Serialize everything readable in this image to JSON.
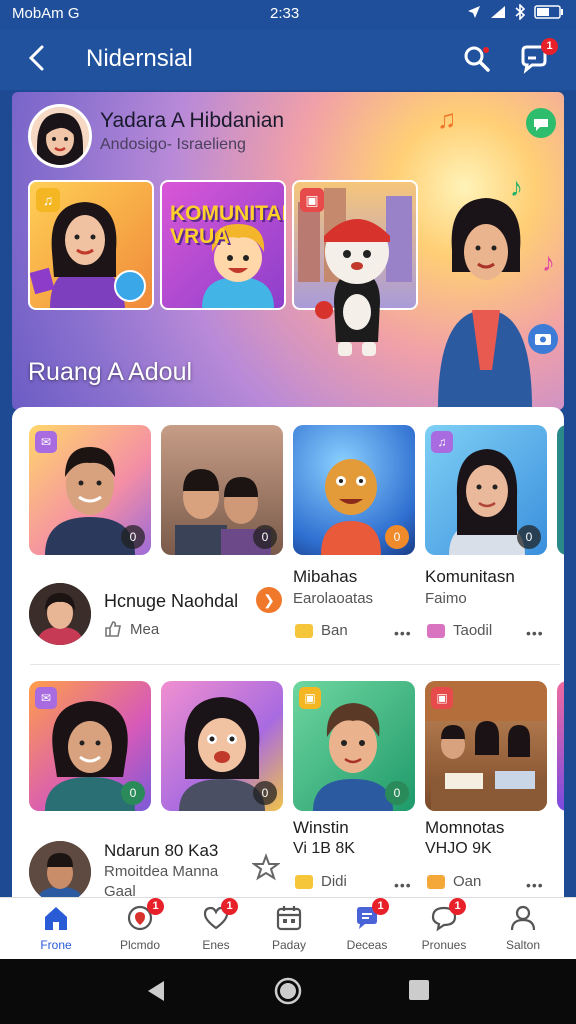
{
  "status": {
    "left": "MobAm G",
    "time": "2:33"
  },
  "appbar": {
    "title": "Nidernsial",
    "chat_badge": "1"
  },
  "hero": {
    "name": "Yadara A Hibdanian",
    "subtitle": "Andosigo- Israelieng",
    "title": "Ruang A Adoul",
    "card_text": "KOMUNITAN VRUA"
  },
  "row1": {
    "badges": [
      "0",
      "0",
      "0",
      "0"
    ],
    "user": {
      "name": "Hcnuge Naohdal",
      "meta": "Mea"
    },
    "items": [
      {
        "title": "Mibahas",
        "sub": "Earolaoatas",
        "meta": "Ban"
      },
      {
        "title": "Komunitasn",
        "sub": "Faimo",
        "meta": "Taodil"
      }
    ]
  },
  "row2": {
    "badges": [
      "0",
      "0",
      "0"
    ],
    "user": {
      "name": "Ndarun 80 Ka3",
      "sub": "Rmoitdea Manna",
      "meta": "Gaal"
    },
    "items": [
      {
        "title": "Winstin",
        "sub": "Vi 1B 8K",
        "meta": "Didi"
      },
      {
        "title": "Momnotas",
        "sub": "VHJO 9K",
        "meta": "Oan"
      }
    ]
  },
  "nav": [
    {
      "label": "Frone",
      "icon": "home-icon",
      "badge": ""
    },
    {
      "label": "Plcmdo",
      "icon": "location-icon",
      "badge": "1"
    },
    {
      "label": "Enes",
      "icon": "heart-icon",
      "badge": "1"
    },
    {
      "label": "Paday",
      "icon": "calendar-icon",
      "badge": ""
    },
    {
      "label": "Deceas",
      "icon": "chat-icon",
      "badge": "1"
    },
    {
      "label": "Pronues",
      "icon": "message-icon",
      "badge": "1"
    },
    {
      "label": "Salton",
      "icon": "profile-icon",
      "badge": ""
    }
  ]
}
